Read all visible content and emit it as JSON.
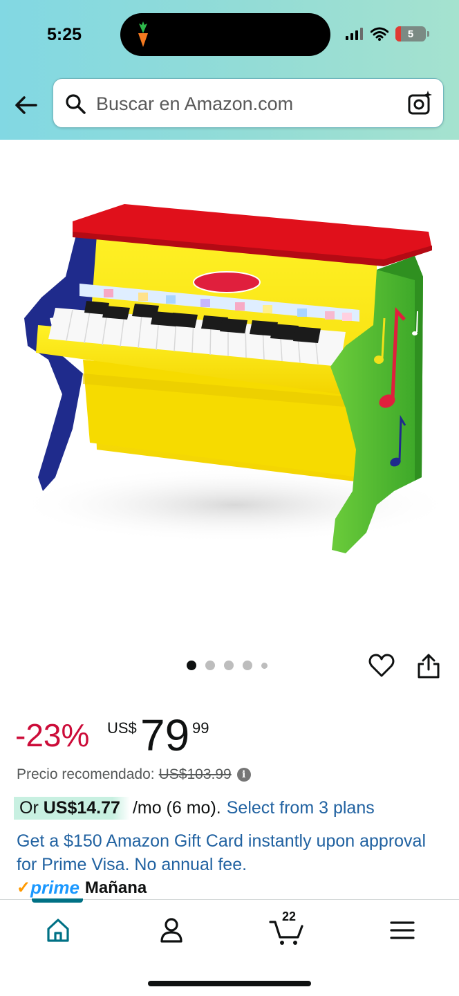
{
  "status_bar": {
    "time": "5:25",
    "battery": "5"
  },
  "header": {
    "search_placeholder": "Buscar en Amazon.com"
  },
  "product": {
    "image_count": 5,
    "active_image_index": 0
  },
  "pricing": {
    "discount": "-23%",
    "currency": "US$",
    "price_whole": "79",
    "price_fraction": "99",
    "list_price_label": "Precio recomendado:",
    "list_price": "US$103.99",
    "info_glyph": "i"
  },
  "financing": {
    "prefix": "Or",
    "amount": "US$14.77",
    "term": "/mo (6 mo).",
    "plans_link": "Select from 3 plans"
  },
  "promo": {
    "text": "Get a $150 Amazon Gift Card instantly upon approval for Prime Visa. No annual fee."
  },
  "delivery": {
    "check": "✓",
    "prime": "prime",
    "day": "Mañana"
  },
  "bottom_nav": {
    "items": [
      "home",
      "account",
      "cart",
      "menu"
    ],
    "active": "home",
    "cart_count": "22"
  },
  "colors": {
    "discount_red": "#cc0c39",
    "link_blue": "#2162a1",
    "prime_blue": "#1a98ff",
    "prime_orange": "#ff9900",
    "nav_active": "#007185",
    "financing_highlight": "#c8f0e1"
  }
}
